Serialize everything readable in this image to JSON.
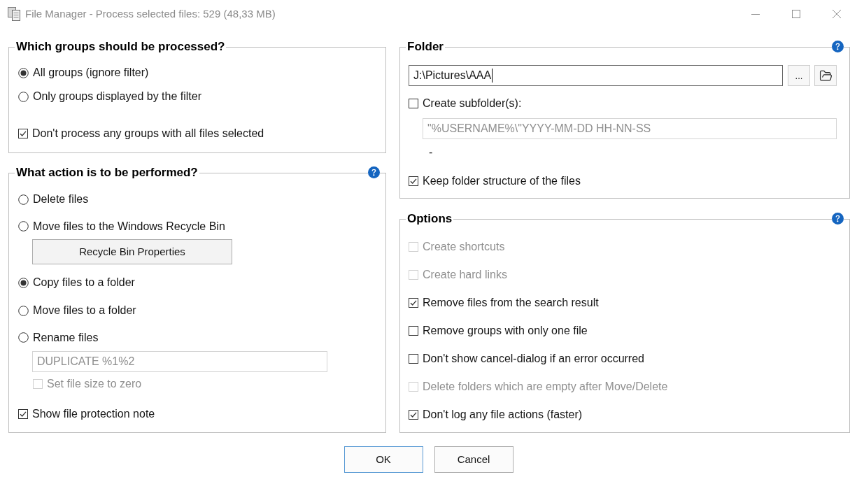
{
  "window": {
    "title": "File Manager - Process selected files: 529 (48,33 MB)"
  },
  "groups_section": {
    "title": "Which groups should be processed?",
    "scope_options": [
      {
        "label": "All groups (ignore filter)",
        "selected": true
      },
      {
        "label": "Only groups displayed by the filter",
        "selected": false
      }
    ],
    "skip_option": {
      "label": "Don't process any groups with all files selected",
      "checked": true
    }
  },
  "action_section": {
    "title": "What action is to be performed?",
    "actions": [
      {
        "label": "Delete files",
        "selected": false
      },
      {
        "label": "Move files to the Windows Recycle Bin",
        "selected": false,
        "children": [
          {
            "kind": "button",
            "label": "Recycle Bin Properties"
          }
        ]
      },
      {
        "label": "Copy files to a folder",
        "selected": true
      },
      {
        "label": "Move files to a folder",
        "selected": false
      },
      {
        "label": "Rename files",
        "selected": false,
        "children": [
          {
            "kind": "field",
            "value": "DUPLICATE %1%2",
            "disabled": true
          },
          {
            "kind": "checkbox",
            "label": "Set file size to zero",
            "checked": false,
            "disabled": true
          }
        ]
      }
    ],
    "protection_note": {
      "label": "Show file protection note",
      "checked": true
    }
  },
  "folder_section": {
    "title": "Folder",
    "path_field": {
      "value": "J:\\Pictures\\AAA",
      "focused": true
    },
    "browse_button": {
      "label": "..."
    },
    "subfolder_option": {
      "label": "Create subfolder(s):",
      "checked": false
    },
    "subfolder_field": {
      "value": "\"%USERNAME%\\\"YYYY-MM-DD HH-NN-SS",
      "disabled": true
    },
    "subfolder_preview": "-",
    "keep_structure_option": {
      "label": "Keep folder structure of the files",
      "checked": true
    }
  },
  "options_section": {
    "title": "Options",
    "options": [
      {
        "label": "Create shortcuts",
        "checked": false,
        "disabled": true
      },
      {
        "label": "Create hard links",
        "checked": false,
        "disabled": true
      },
      {
        "label": "Remove files from the search result",
        "checked": true,
        "disabled": false
      },
      {
        "label": "Remove groups with only one file",
        "checked": false,
        "disabled": false
      },
      {
        "label": "Don't show cancel-dialog if an error occurred",
        "checked": false,
        "disabled": false
      },
      {
        "label": "Delete folders which are empty after Move/Delete",
        "checked": false,
        "disabled": true
      },
      {
        "label": "Don't log any file actions (faster)",
        "checked": true,
        "disabled": false
      }
    ]
  },
  "buttons": [
    {
      "label": "OK",
      "default": true
    },
    {
      "label": "Cancel",
      "default": false
    }
  ]
}
